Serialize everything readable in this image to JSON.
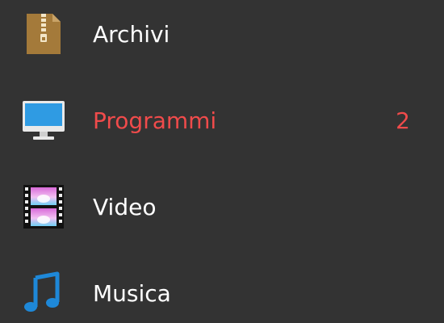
{
  "menu": {
    "items": [
      {
        "label": "Archivi",
        "icon": "zip-archive-icon",
        "active": false,
        "count": ""
      },
      {
        "label": "Programmi",
        "icon": "computer-monitor-icon",
        "active": true,
        "count": "2"
      },
      {
        "label": "Video",
        "icon": "film-strip-icon",
        "active": false,
        "count": ""
      },
      {
        "label": "Musica",
        "icon": "music-note-icon",
        "active": false,
        "count": ""
      }
    ]
  },
  "colors": {
    "background": "#333333",
    "text": "#ffffff",
    "active": "#f04b4b",
    "zip": "#a47a3a",
    "monitor": "#2f9be3",
    "music": "#1e88d8"
  }
}
